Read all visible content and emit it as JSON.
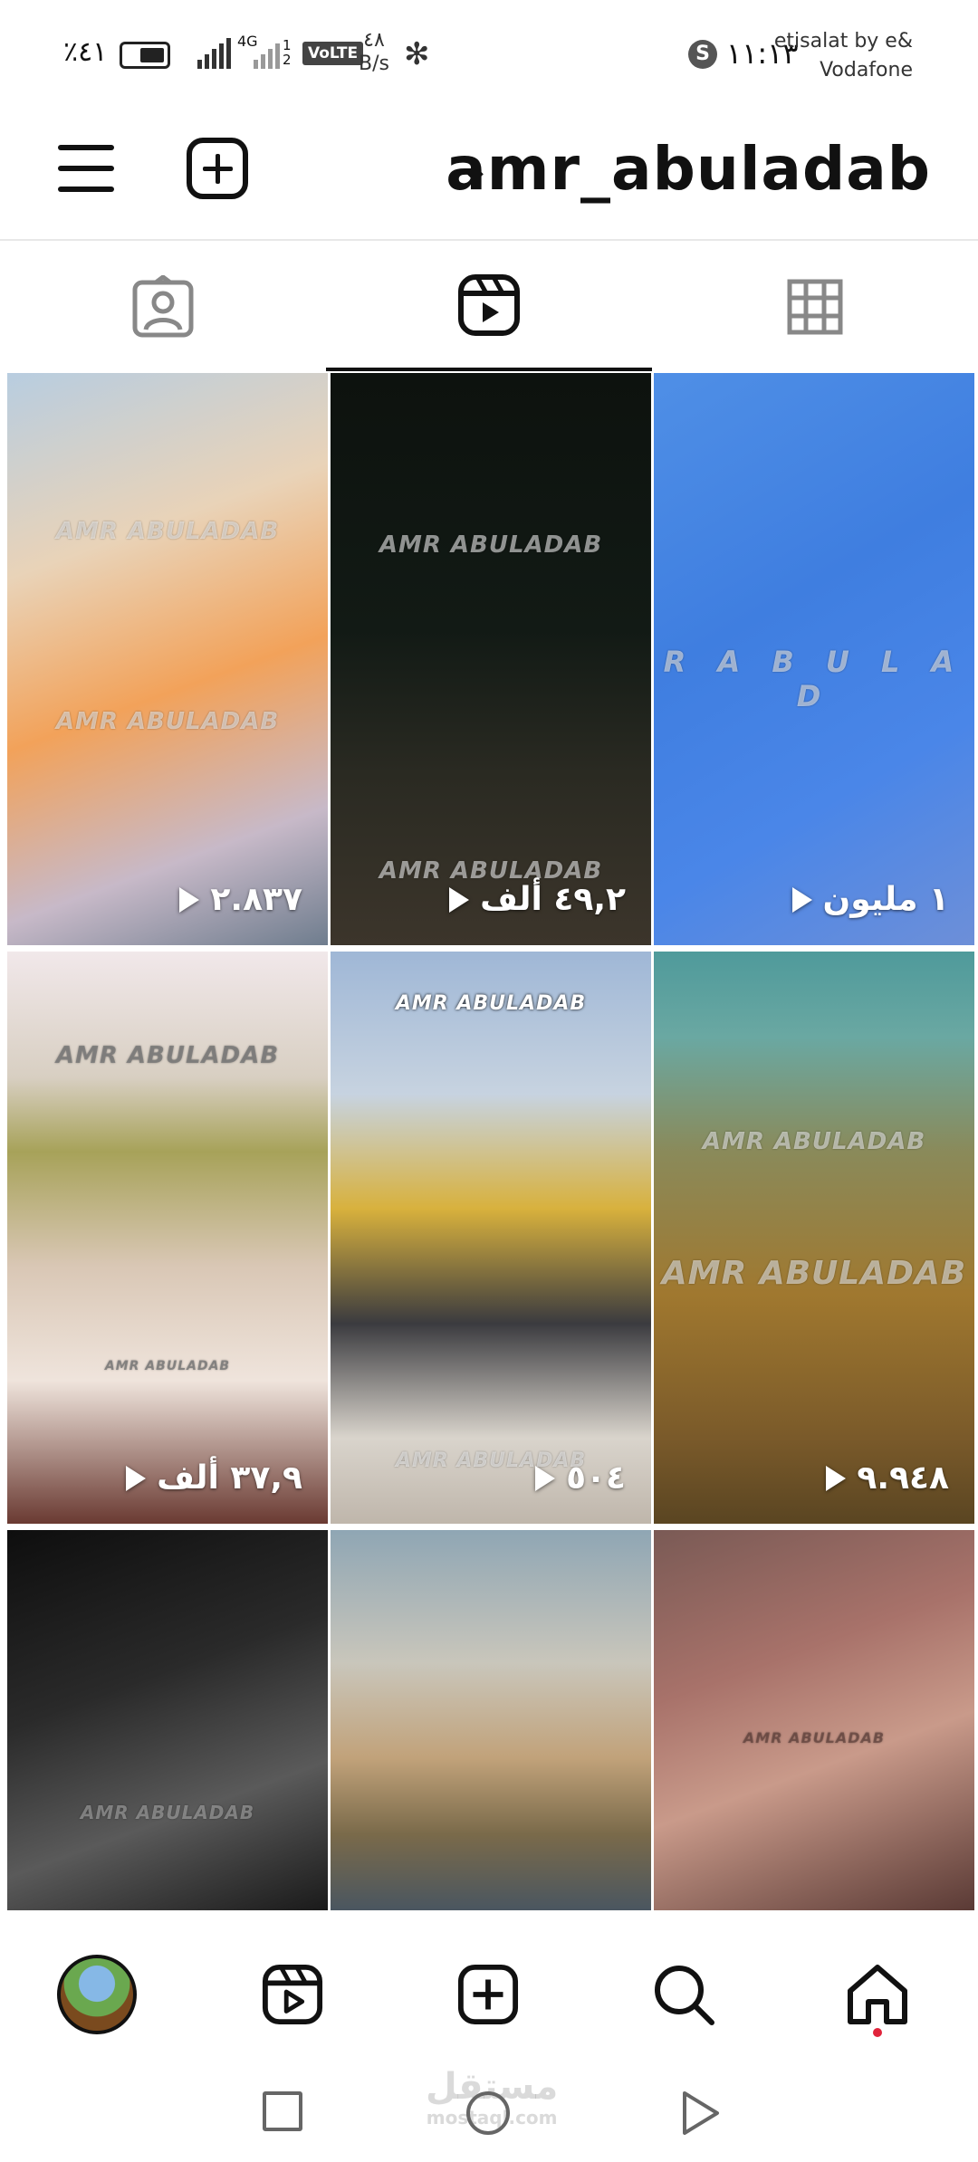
{
  "status_bar": {
    "battery": "٪٤١",
    "network_gen": "4G",
    "sim_slots": "1 2",
    "volte": "VoLTE",
    "speed_value": "٤٨",
    "speed_unit": "B/s",
    "time": "١١:١٣",
    "carrier_line1": "etisalat by e&",
    "carrier_line2": "Vodafone"
  },
  "header": {
    "username": "amr_abuladab"
  },
  "tabs": [
    {
      "name": "tagged",
      "icon": "tagged-person-icon"
    },
    {
      "name": "reels",
      "icon": "reels-icon",
      "active": true
    },
    {
      "name": "posts",
      "icon": "grid-icon"
    }
  ],
  "reels": [
    {
      "count": "٢.٨٣٧",
      "watermark": "AMR ABULADAB",
      "bg": "linear-gradient(160deg,#b8cde0 0%,#e9d3b8 30%,#f2a25a 55%,#c7b9c8 80%,#6f7d8e 100%)"
    },
    {
      "count": "٤٩,٢ ألف",
      "watermark": "AMR ABULADAB",
      "bg": "linear-gradient(180deg,#0d120e 0%,#121a15 45%,#2a2a22 70%,#3c352b 100%)"
    },
    {
      "count": "١ مليون",
      "watermark": "R A B U L A D",
      "bg": "linear-gradient(150deg,#4f8fe6 0%,#3f7ee0 40%,#4a86e8 70%,#6d8fd8 100%)"
    },
    {
      "count": "٣٧,٩ ألف",
      "watermark": "AMR ABULADAB",
      "bg": "linear-gradient(180deg,#f1e8ea 0%,#d8cfc2 22%,#a7a259 35%,#d9c7b5 55%,#efe4dc 75%,#6a3a32 100%)"
    },
    {
      "count": "٥٠٤",
      "watermark": "AMR ABULADAB",
      "bg": "linear-gradient(180deg,#9fb7d6 0%,#c7d3e0 25%,#d8b13d 45%,#3b3b3f 65%,#d9d4cc 85%,#bfb6ab 100%)"
    },
    {
      "count": "٩.٩٤٨",
      "watermark": "AMR ABULADAB",
      "bg": "linear-gradient(180deg,#4f9a9b 0%,#6aa8a2 15%,#8a8a5a 35%,#a0782f 60%,#7a5a2a 85%,#5a4522 100%)"
    },
    {
      "count": "",
      "watermark": "AMR ABULADAB",
      "bg": "linear-gradient(160deg,#0e0e0e 0%,#2a2a2a 40%,#5a5a5a 70%,#1a1a1a 100%)"
    },
    {
      "count": "",
      "watermark": "",
      "bg": "linear-gradient(180deg,#8fa6b4 0%,#c9c6bb 35%,#c1a27a 60%,#7a6a4a 80%,#4a5660 100%)"
    },
    {
      "count": "",
      "watermark": "AMR ABULADAB",
      "bg": "linear-gradient(160deg,#7a5a55 0%,#a8726a 35%,#c99a8a 60%,#5a3a35 100%)"
    }
  ],
  "bottom_nav": [
    {
      "name": "profile",
      "icon": "avatar"
    },
    {
      "name": "reels",
      "icon": "reels-icon"
    },
    {
      "name": "create",
      "icon": "add-icon"
    },
    {
      "name": "search",
      "icon": "search-icon"
    },
    {
      "name": "home",
      "icon": "home-icon"
    }
  ],
  "site_watermark": {
    "ar": "مستقل",
    "en": "mostaql.com"
  }
}
